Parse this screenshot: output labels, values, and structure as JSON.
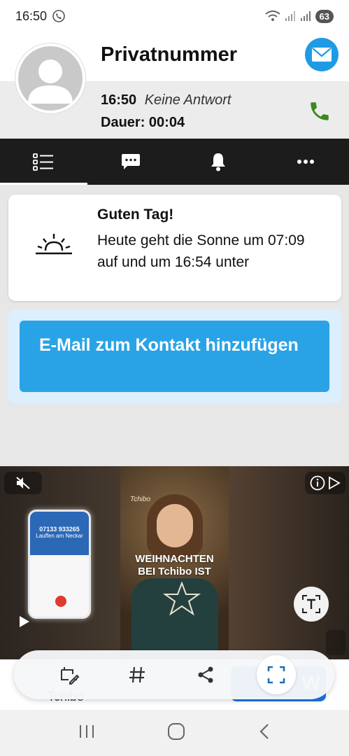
{
  "status_bar": {
    "time": "16:50",
    "battery": "63"
  },
  "contact": {
    "name": "Privatnummer"
  },
  "call": {
    "time": "16:50",
    "status": "Keine Antwort",
    "duration_label": "Dauer:",
    "duration": "00:04"
  },
  "tabs": [
    {
      "icon": "list-icon",
      "active": true
    },
    {
      "icon": "chat-icon",
      "active": false
    },
    {
      "icon": "bell-icon",
      "active": false
    },
    {
      "icon": "more-icon",
      "active": false
    }
  ],
  "greeting": {
    "title": "Guten Tag!",
    "text": "Heute geht die Sonne um 07:09 auf und um 16:54 unter"
  },
  "email_action": {
    "label": "E-Mail zum Kontakt hinzufügen"
  },
  "ad": {
    "phone_number": "07133 933265",
    "phone_location": "Lauffen am Neckar",
    "slogan_line1": "WEIHNACHTEN",
    "slogan_line2": "BEI Tchibo IST",
    "brand_small": "Tchibo"
  },
  "ad_footer": {
    "brand": "Tchibo",
    "button_fragment": "W"
  },
  "colors": {
    "accent": "#2aa3e6",
    "mail": "#1e9be4",
    "phone_green": "#3a8a1e",
    "tabbar": "#1c1c1c"
  }
}
